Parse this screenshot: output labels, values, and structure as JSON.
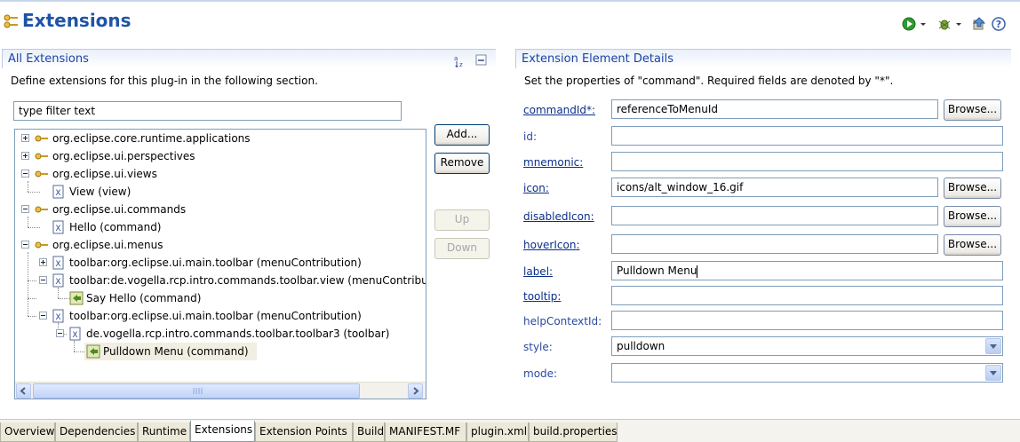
{
  "header": {
    "title": "Extensions"
  },
  "all_extensions": {
    "title": "All Extensions",
    "description": "Define extensions for this plug-in in the following section.",
    "filter_placeholder": "type filter text",
    "buttons": {
      "add": "Add...",
      "remove": "Remove",
      "up": "Up",
      "down": "Down"
    },
    "tree": [
      {
        "label": "org.eclipse.core.runtime.applications"
      },
      {
        "label": "org.eclipse.ui.perspectives"
      },
      {
        "label": "org.eclipse.ui.views"
      },
      {
        "label": "View (view)"
      },
      {
        "label": "org.eclipse.ui.commands"
      },
      {
        "label": "Hello (command)"
      },
      {
        "label": "org.eclipse.ui.menus"
      },
      {
        "label": "toolbar:org.eclipse.ui.main.toolbar (menuContribution)"
      },
      {
        "label": "toolbar:de.vogella.rcp.intro.commands.toolbar.view (menuContribution)"
      },
      {
        "label": "Say Hello (command)"
      },
      {
        "label": "toolbar:org.eclipse.ui.main.toolbar (menuContribution)"
      },
      {
        "label": "de.vogella.rcp.intro.commands.toolbar.toolbar3 (toolbar)"
      },
      {
        "label": "Pulldown Menu (command)"
      }
    ]
  },
  "details": {
    "title": "Extension Element Details",
    "description": "Set the properties of \"command\". Required fields are denoted by \"*\".",
    "browse_label": "Browse...",
    "fields": {
      "commandId": {
        "label": "commandId*:",
        "value": "referenceToMenuId"
      },
      "id": {
        "label": "id:",
        "value": ""
      },
      "mnemonic": {
        "label": "mnemonic:",
        "value": ""
      },
      "icon": {
        "label": "icon:",
        "value": "icons/alt_window_16.gif"
      },
      "disabledIcon": {
        "label": "disabledIcon:",
        "value": ""
      },
      "hoverIcon": {
        "label": "hoverIcon:",
        "value": ""
      },
      "label": {
        "label": "label:",
        "value": "Pulldown Menu"
      },
      "tooltip": {
        "label": "tooltip:",
        "value": ""
      },
      "helpContextId": {
        "label": "helpContextId:",
        "value": ""
      },
      "style": {
        "label": "style:",
        "value": "pulldown"
      },
      "mode": {
        "label": "mode:",
        "value": ""
      }
    }
  },
  "tabs": [
    "Overview",
    "Dependencies",
    "Runtime",
    "Extensions",
    "Extension Points",
    "Build",
    "MANIFEST.MF",
    "plugin.xml",
    "build.properties"
  ],
  "colors": {
    "title": "#1f53a7",
    "link": "#0a2e8a",
    "selection": "#f1efe2"
  }
}
